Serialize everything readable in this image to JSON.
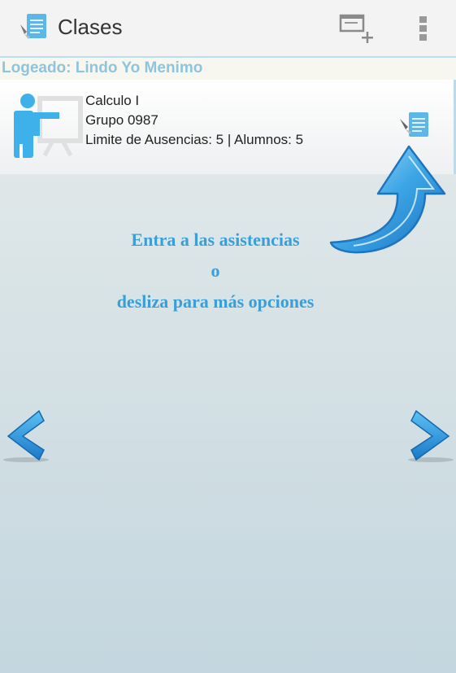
{
  "app": {
    "title": "Clases",
    "icons": [
      "app-logo-icon",
      "add-class-icon",
      "overflow-menu-icon"
    ]
  },
  "session": {
    "logged_label": "Logeado: Lindo Yo Menimo"
  },
  "classes": [
    {
      "name": "Calculo I",
      "group": "Grupo 0987",
      "details": "Limite de Ausencias: 5  |  Alumnos: 5"
    }
  ],
  "hint": {
    "line1": "Entra a las asistencias",
    "line2": "o",
    "line3": "desliza para más opciones"
  },
  "colors": {
    "accent": "#3a9fd9",
    "logged_text": "#8fc4df",
    "action_bar": "#f3f3f3"
  }
}
